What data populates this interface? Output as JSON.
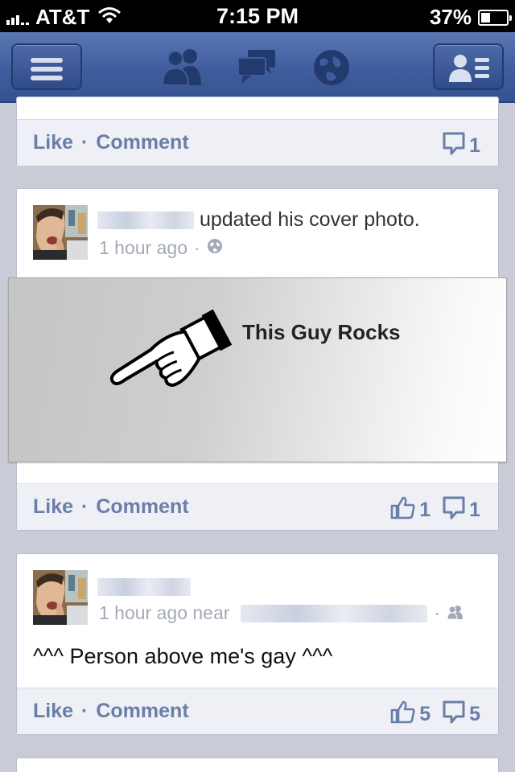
{
  "status_bar": {
    "carrier": "AT&T",
    "time": "7:15 PM",
    "battery": "37%",
    "battery_level": 0.37
  },
  "nav": {
    "menu_icon": "menu-icon",
    "friends_icon": "friend-requests-icon",
    "messages_icon": "messages-icon",
    "notifications_icon": "globe-icon",
    "contacts_icon": "contacts-icon"
  },
  "posts": [
    {
      "actions": {
        "like": "Like",
        "separator": "·",
        "comment": "Comment"
      },
      "comment_count": "1"
    },
    {
      "headline_action": "updated his cover photo.",
      "timestamp": "1 hour ago",
      "meta_separator": "·",
      "privacy_icon": "globe-icon",
      "cover_text": "This Guy Rocks",
      "actions": {
        "like": "Like",
        "separator": "·",
        "comment": "Comment"
      },
      "like_count": "1",
      "comment_count": "1"
    },
    {
      "timestamp": "1 hour ago near",
      "meta_separator": "·",
      "privacy_icon": "friends-icon",
      "text": "^^^ Person above me's gay ^^^",
      "actions": {
        "like": "Like",
        "separator": "·",
        "comment": "Comment"
      },
      "like_count": "5",
      "comment_count": "5"
    }
  ],
  "colors": {
    "nav_blue": "#3f5d9e",
    "link_blue": "#6a7ea8",
    "feed_bg": "#c9ccd6"
  }
}
